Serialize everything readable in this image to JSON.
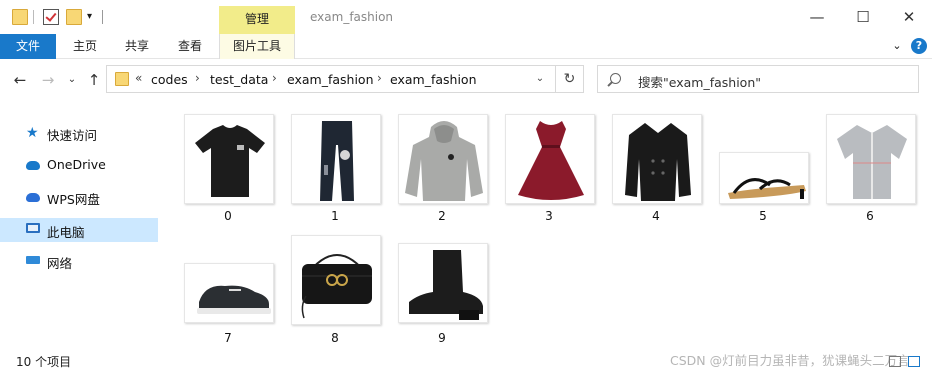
{
  "window": {
    "title": "exam_fashion",
    "manage_tab": "管理",
    "minimize_glyph": "—",
    "maximize_glyph": "☐",
    "close_glyph": "✕"
  },
  "ribbon": {
    "tabs": [
      "文件",
      "主页",
      "共享",
      "查看",
      "图片工具"
    ],
    "collapse_glyph": "⌄",
    "help_glyph": "?"
  },
  "nav_buttons": {
    "back": "←",
    "forward": "→",
    "recent": "⌄",
    "up": "↑"
  },
  "address": {
    "overflow": "«",
    "segments": [
      "codes",
      "test_data",
      "exam_fashion",
      "exam_fashion"
    ],
    "separator": "›",
    "dropdown_glyph": "⌄",
    "refresh_glyph": "↻"
  },
  "search": {
    "placeholder": "搜索\"exam_fashion\""
  },
  "nav_pane": {
    "items": [
      {
        "label": "快速访问",
        "icon": "star-icon"
      },
      {
        "label": "OneDrive",
        "icon": "cloud-icon"
      },
      {
        "label": "WPS网盘",
        "icon": "wps-cloud-icon"
      },
      {
        "label": "此电脑",
        "icon": "computer-icon",
        "selected": true
      },
      {
        "label": "网络",
        "icon": "network-icon"
      }
    ]
  },
  "files": [
    {
      "name": "0",
      "icon": "tshirt-thumbnail"
    },
    {
      "name": "1",
      "icon": "jeans-thumbnail"
    },
    {
      "name": "2",
      "icon": "hoodie-thumbnail"
    },
    {
      "name": "3",
      "icon": "dress-thumbnail"
    },
    {
      "name": "4",
      "icon": "coat-thumbnail"
    },
    {
      "name": "5",
      "icon": "sandal-thumbnail"
    },
    {
      "name": "6",
      "icon": "shirt-thumbnail"
    },
    {
      "name": "7",
      "icon": "sneaker-thumbnail"
    },
    {
      "name": "8",
      "icon": "handbag-thumbnail"
    },
    {
      "name": "9",
      "icon": "boot-thumbnail"
    }
  ],
  "status": {
    "item_count": "10 个项目"
  },
  "watermark": "CSDN @灯前目力虽非昔，犹课蝇头二万言",
  "colors": {
    "accent": "#1979ca",
    "manage_tab": "#f2ec8a",
    "selection": "#cce8ff"
  }
}
